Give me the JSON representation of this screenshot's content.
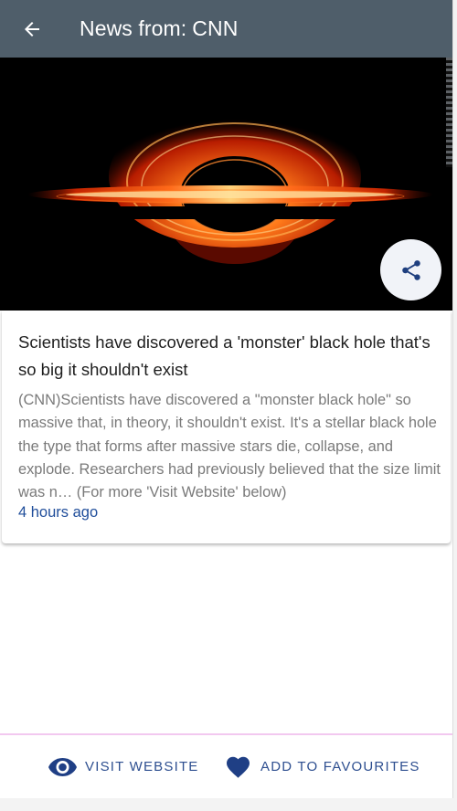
{
  "appbar": {
    "title_prefix": "News from:",
    "source_name": "CNN",
    "back_icon": "arrow-left-icon"
  },
  "hero": {
    "image_subject": "black hole accretion disk",
    "share_icon": "share-icon"
  },
  "article": {
    "headline": "Scientists have discovered a 'monster' black hole that's so big it shouldn't exist",
    "summary": "(CNN)Scientists have discovered a \"monster black hole\" so massive that, in theory, it shouldn't exist. It's a stellar black hole the type that forms after massive stars die, collapse, and explode. Researchers had previously believed that the size limit was n… (For more 'Visit Website' below)",
    "published": "4 hours ago"
  },
  "bottom_bar": {
    "visit_label": "VISIT WEBSITE",
    "visit_icon": "eye-icon",
    "favourite_label": "ADD TO FAVOURITES",
    "favourite_icon": "heart-icon"
  },
  "colors": {
    "appbar_bg": "#4f5e6a",
    "accent_blue": "#1f4d9a",
    "divider_pink": "#f2c8f0"
  }
}
